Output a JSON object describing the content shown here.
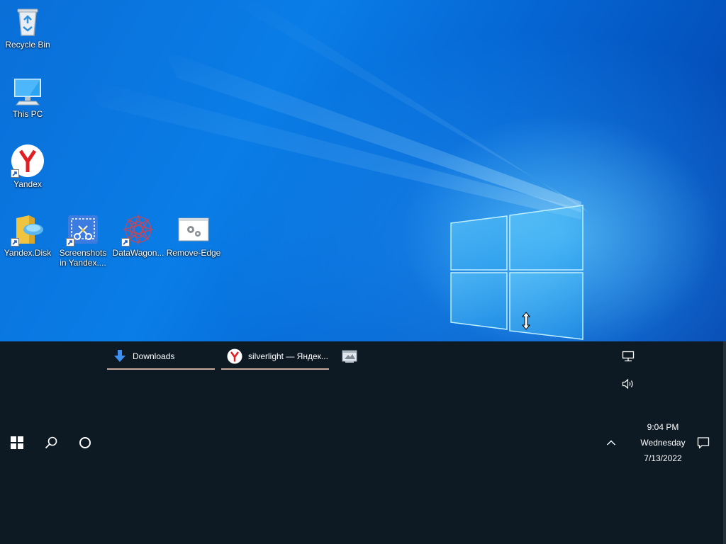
{
  "desktop": {
    "icons": [
      {
        "label": "Recycle Bin",
        "icon": "recycle-bin-icon"
      },
      {
        "label": "This PC",
        "icon": "computer-icon"
      },
      {
        "label": "Yandex",
        "icon": "yandex-browser-icon"
      },
      {
        "label": "Yandex.Disk",
        "icon": "yandex-disk-icon"
      },
      {
        "label": "Screenshots in Yandex....",
        "icon": "screenshots-icon"
      },
      {
        "label": "DataWagon...",
        "icon": "datawagon-icon"
      },
      {
        "label": "Remove-Edge",
        "icon": "batch-file-icon"
      }
    ]
  },
  "taskbar": {
    "start_icon": "windows-start-icon",
    "search_icon": "search-icon",
    "cortana_icon": "cortana-icon",
    "tasks": [
      {
        "label": "Downloads",
        "icon": "download-arrow-icon"
      },
      {
        "label": "silverlight — Яндек...",
        "icon": "yandex-browser-icon"
      },
      {
        "label": "",
        "icon": "app-window-icon"
      }
    ],
    "tray": {
      "network_icon": "network-icon",
      "volume_icon": "volume-icon",
      "chevron_icon": "chevron-up-icon",
      "notification_icon": "notification-icon"
    },
    "clock": {
      "time": "9:04 PM",
      "day": "Wednesday",
      "date": "7/13/2022"
    }
  },
  "colors": {
    "taskbar_bg": "#0d1a24",
    "accent_underline": "#c9a999",
    "yandex_red": "#e21e24"
  }
}
